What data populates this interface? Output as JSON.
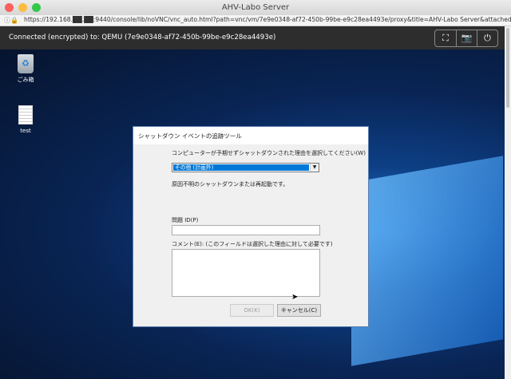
{
  "window": {
    "title": "AHV-Labo Server"
  },
  "browser": {
    "url": "https://192.168.██.██:9440/console/lib/noVNC/vnc_auto.html?path=vnc/vm/7e9e0348-af72-450b-99be-e9c28ea4493e/proxy&title=AHV-Labo Server&attached=false"
  },
  "vnc": {
    "status": "Connected (encrypted) to: QEMU (7e9e0348-af72-450b-99be-e9c28ea4493e)",
    "buttons": [
      "network-icon",
      "camera-icon",
      "power-icon"
    ]
  },
  "desktop": {
    "icons": [
      {
        "label": "ごみ箱",
        "icon": "recycle-bin-icon"
      },
      {
        "label": "test",
        "icon": "document-icon"
      }
    ]
  },
  "dialog": {
    "title": "シャットダウン イベントの追跡ツール",
    "reason_prompt": "コンピューターが予期せずシャットダウンされた理由を選択してください(W)",
    "reason_selected": "その他 (計画外)",
    "reason_description": "原因不明のシャットダウンまたは再起動です。",
    "problem_id_label": "問題 ID(P)",
    "problem_id_value": "",
    "comment_label": "コメント(E): (このフィールドは選択した理由に対して必要です)",
    "comment_value": "",
    "ok_label": "OK(K)",
    "cancel_label": "キャンセル(C)"
  }
}
